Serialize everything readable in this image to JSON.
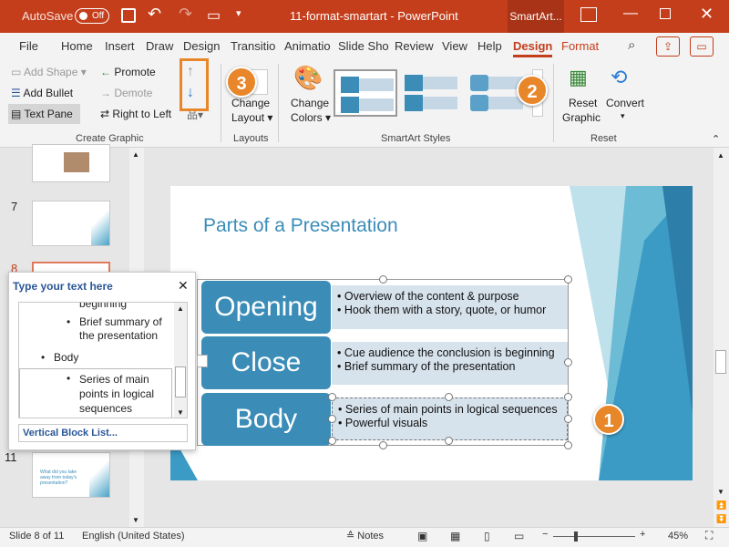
{
  "titlebar": {
    "autosave": "AutoSave",
    "autosave_state": "Off",
    "doc_title": "11-format-smartart  -  PowerPoint",
    "context_tab": "SmartArt..."
  },
  "tabs": [
    "File",
    "Home",
    "Insert",
    "Draw",
    "Design",
    "Transitio",
    "Animatio",
    "Slide Sho",
    "Review",
    "View",
    "Help",
    "Design",
    "Format"
  ],
  "ribbon": {
    "add_shape": "Add Shape",
    "promote": "Promote",
    "add_bullet": "Add Bullet",
    "demote": "Demote",
    "text_pane": "Text Pane",
    "right_to_left": "Right to Left",
    "change_layout_1": "Change",
    "change_layout_2": "Layout",
    "change_colors_1": "Change",
    "change_colors_2": "Colors",
    "reset_graphic_1": "Reset",
    "reset_graphic_2": "Graphic",
    "convert": "Convert",
    "groups": {
      "create": "Create Graphic",
      "layouts": "Layouts",
      "styles": "SmartArt Styles",
      "reset": "Reset"
    }
  },
  "thumbnails": {
    "slide7_num": "7",
    "slide8_num": "8",
    "slide11_num": "11",
    "slide11_text": "What did you take away from today's presentation?"
  },
  "slide": {
    "title": "Parts of a Presentation",
    "blocks": [
      {
        "label": "Opening",
        "bullets": [
          "Overview of the content & purpose",
          "Hook them with a story, quote, or humor"
        ]
      },
      {
        "label": "Close",
        "bullets": [
          "Cue audience the conclusion is beginning",
          "Brief summary of the presentation"
        ]
      },
      {
        "label": "Body",
        "bullets": [
          "Series of main points in logical sequences",
          "Powerful visuals"
        ]
      }
    ]
  },
  "textpane": {
    "title": "Type your text here",
    "items": [
      "beginning",
      "Brief summary of the presentation",
      "Body",
      "Series of main points in logical sequences"
    ],
    "footer": "Vertical Block List..."
  },
  "callouts": [
    "1",
    "2",
    "3"
  ],
  "status": {
    "slide": "Slide 8 of 11",
    "lang": "English (United States)",
    "notes": "Notes",
    "zoom": "45%"
  }
}
